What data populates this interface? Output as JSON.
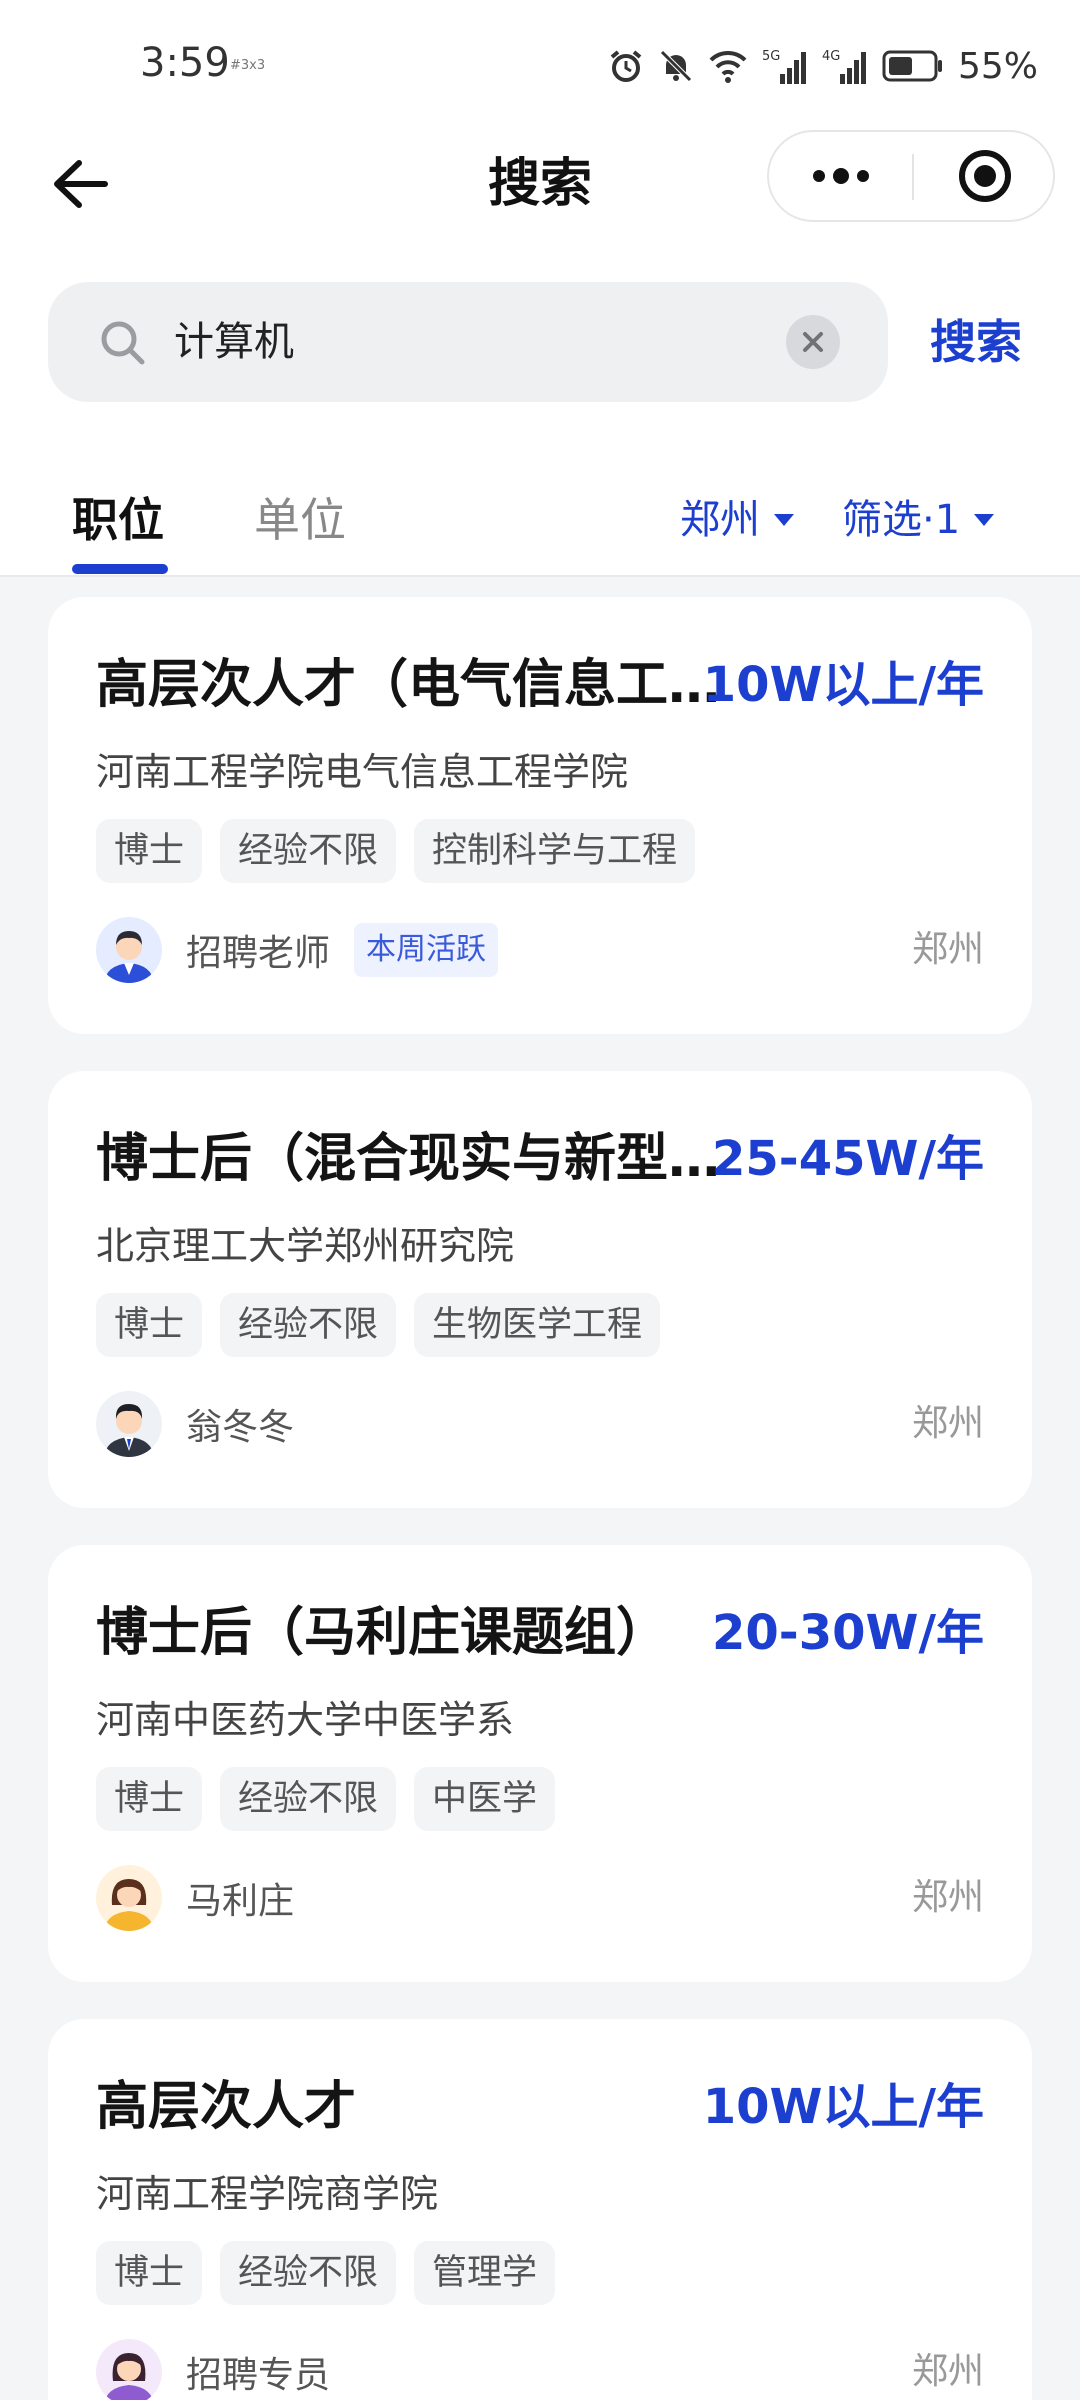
{
  "status_bar": {
    "time": "3:59",
    "carrier_note": "#3x3",
    "signal_1": "5G",
    "signal_2": "4G",
    "battery_percent": "55%",
    "battery_level": 0.55,
    "icons": [
      "alarm-icon",
      "mute-icon",
      "wifi-icon",
      "signal-5g-icon",
      "signal-4g-icon",
      "battery-icon"
    ]
  },
  "nav": {
    "title": "搜索",
    "back_icon": "arrow-left-icon",
    "more_icon": "more-dots-icon",
    "close_icon": "target-circle-icon"
  },
  "search": {
    "query": "计算机",
    "button_label": "搜索",
    "search_icon": "search-icon",
    "clear_icon": "clear-x-icon"
  },
  "tabs": {
    "items": [
      {
        "label": "职位",
        "active": true
      },
      {
        "label": "单位",
        "active": false
      }
    ],
    "filter_city": "郑州",
    "filter_more": "筛选·1"
  },
  "colors": {
    "accent": "#1d3fd0",
    "background": "#f4f5f7",
    "card": "#ffffff",
    "tag_bg": "#f3f4f6",
    "badge_bg": "#eef2ff"
  },
  "jobs": [
    {
      "title": "高层次人才（电气信息工程学院）",
      "salary": "10W以上/年",
      "org": "河南工程学院电气信息工程学院",
      "tags": [
        "博士",
        "经验不限",
        "控制科学与工程"
      ],
      "recruiter": "招聘老师",
      "badge": "本周活跃",
      "city": "郑州"
    },
    {
      "title": "博士后（混合现实与新型显示）",
      "salary": "25-45W/年",
      "org": "北京理工大学郑州研究院",
      "tags": [
        "博士",
        "经验不限",
        "生物医学工程"
      ],
      "recruiter": "翁冬冬",
      "city": "郑州"
    },
    {
      "title": "博士后（马利庄课题组）",
      "salary": "20-30W/年",
      "org": "河南中医药大学中医学系",
      "tags": [
        "博士",
        "经验不限",
        "中医学"
      ],
      "recruiter": "马利庄",
      "city": "郑州"
    },
    {
      "title": "高层次人才",
      "salary": "10W以上/年",
      "org": "河南工程学院商学院",
      "tags": [
        "博士",
        "经验不限",
        "管理学"
      ],
      "recruiter": "招聘专员",
      "city": "郑州"
    }
  ]
}
